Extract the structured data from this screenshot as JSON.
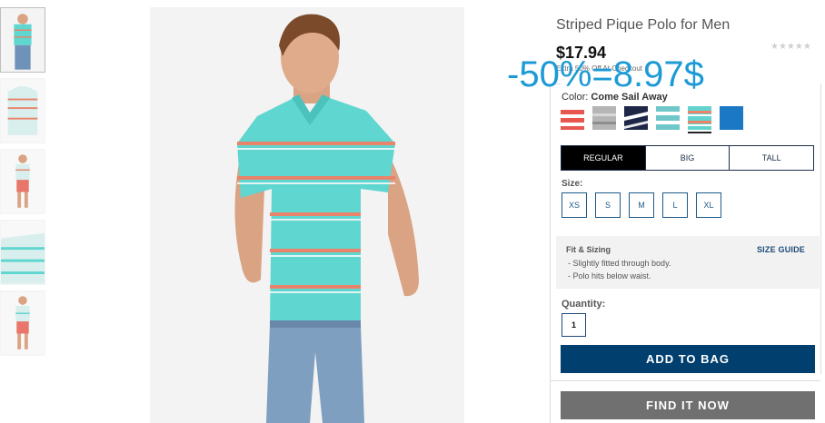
{
  "product": {
    "title": "Striped Pique Polo for Men",
    "rating_stars": "★★★★★",
    "price": "$17.94",
    "promo": "Extra 50% Off At Checkout",
    "overlay_discount": "-50%=8.97$"
  },
  "color": {
    "label": "Color:",
    "selected_name": "Come Sail Away",
    "swatches": [
      {
        "name": "coral-stripe",
        "color": "#e8574f"
      },
      {
        "name": "heather-gray",
        "color": "#9b9b9b"
      },
      {
        "name": "navy-stripe",
        "color": "#1e2748"
      },
      {
        "name": "aqua-white",
        "color": "#6fc7c9"
      },
      {
        "name": "come-sail-away",
        "color": "#63d3cf",
        "selected": true
      },
      {
        "name": "blue",
        "color": "#1b78c4"
      }
    ]
  },
  "fit_tabs": [
    {
      "label": "REGULAR",
      "active": true
    },
    {
      "label": "BIG",
      "active": false
    },
    {
      "label": "TALL",
      "active": false
    }
  ],
  "size": {
    "label": "Size:",
    "options": [
      "XS",
      "S",
      "M",
      "L",
      "XL"
    ]
  },
  "fit_sizing": {
    "title": "Fit & Sizing",
    "guide_link": "SIZE GUIDE",
    "bullets": [
      "- Slightly fitted through body.",
      "- Polo hits below waist."
    ]
  },
  "quantity": {
    "label": "Quantity:",
    "value": "1"
  },
  "buttons": {
    "add_to_bag": "ADD TO BAG",
    "find_it_now": "FIND IT NOW"
  },
  "theme": {
    "shirt_color": "#5fd6cf",
    "stripe_color": "#e9846b",
    "accent_blue": "#003f6e"
  }
}
